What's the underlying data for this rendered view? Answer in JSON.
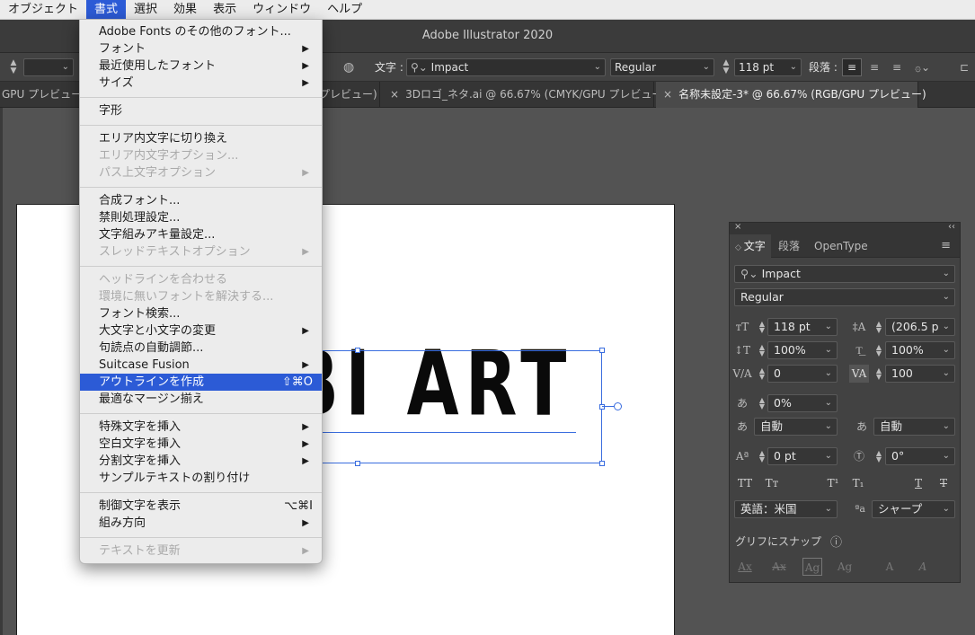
{
  "menubar": {
    "items": [
      "オブジェクト",
      "書式",
      "選択",
      "効果",
      "表示",
      "ウィンドウ",
      "ヘルプ"
    ]
  },
  "app_title": "Adobe Illustrator 2020",
  "control_bar": {
    "type_label": "文字 :",
    "font": "Impact",
    "style": "Regular",
    "size": "118 pt",
    "paragraph_label": "段落 :"
  },
  "doc_tabs": [
    {
      "label": "GPU プレビュー)"
    },
    {
      "label": "プレビュー)"
    },
    {
      "label": "3Dロゴ_ネタ.ai @ 66.67% (CMYK/GPU プレビュー)"
    },
    {
      "label": "名称未設定-3* @ 66.67% (RGB/GPU プレビュー)"
    }
  ],
  "canvas": {
    "art_text": "BI ART"
  },
  "type_menu": {
    "items": [
      {
        "label": "Adobe Fonts のその他のフォント...",
        "sub": false,
        "disabled": false
      },
      {
        "label": "フォント",
        "sub": true,
        "disabled": false
      },
      {
        "label": "最近使用したフォント",
        "sub": true,
        "disabled": false
      },
      {
        "label": "サイズ",
        "sub": true,
        "disabled": false
      },
      {
        "label": "字形",
        "sub": false,
        "disabled": false
      },
      {
        "label": "エリア内文字に切り換え",
        "sub": false,
        "disabled": false
      },
      {
        "label": "エリア内文字オプション...",
        "sub": false,
        "disabled": true
      },
      {
        "label": "パス上文字オプション",
        "sub": true,
        "disabled": true
      },
      {
        "label": "合成フォント...",
        "sub": false,
        "disabled": false
      },
      {
        "label": "禁則処理設定...",
        "sub": false,
        "disabled": false
      },
      {
        "label": "文字組みアキ量設定...",
        "sub": false,
        "disabled": false
      },
      {
        "label": "スレッドテキストオプション",
        "sub": true,
        "disabled": true
      },
      {
        "label": "ヘッドラインを合わせる",
        "sub": false,
        "disabled": true
      },
      {
        "label": "環境に無いフォントを解決する...",
        "sub": false,
        "disabled": true
      },
      {
        "label": "フォント検索...",
        "sub": false,
        "disabled": false
      },
      {
        "label": "大文字と小文字の変更",
        "sub": true,
        "disabled": false
      },
      {
        "label": "句読点の自動調節...",
        "sub": false,
        "disabled": false
      },
      {
        "label": "Suitcase Fusion",
        "sub": true,
        "disabled": false
      },
      {
        "label": "アウトラインを作成",
        "sub": false,
        "disabled": false,
        "shortcut": "⇧⌘O",
        "selected": true
      },
      {
        "label": "最適なマージン揃え",
        "sub": false,
        "disabled": false
      },
      {
        "label": "特殊文字を挿入",
        "sub": true,
        "disabled": false
      },
      {
        "label": "空白文字を挿入",
        "sub": true,
        "disabled": false
      },
      {
        "label": "分割文字を挿入",
        "sub": true,
        "disabled": false
      },
      {
        "label": "サンプルテキストの割り付け",
        "sub": false,
        "disabled": false
      },
      {
        "label": "制御文字を表示",
        "sub": false,
        "disabled": false,
        "shortcut": "⌥⌘I"
      },
      {
        "label": "組み方向",
        "sub": true,
        "disabled": false
      },
      {
        "label": "テキストを更新",
        "sub": true,
        "disabled": true
      }
    ]
  },
  "char_panel": {
    "tabs": [
      "文字",
      "段落",
      "OpenType"
    ],
    "font": "Impact",
    "style": "Regular",
    "size": "118 pt",
    "leading": "(206.5 p",
    "vscale": "100%",
    "hscale": "100%",
    "kerning": "0",
    "tracking": "100",
    "tsume": "0%",
    "aki_left": "自動",
    "aki_right": "自動",
    "baseline_shift": "0 pt",
    "rotation": "0°",
    "language": "英語：米国",
    "antialias": "シャープ",
    "snap_label": "グリフにスナップ",
    "type_buttons": [
      "TT",
      "Tт",
      "T¹",
      "T₁",
      "T",
      "T"
    ],
    "snap_buttons": [
      "Ax",
      "Ax",
      "Ag",
      "Ag",
      "A",
      "A"
    ]
  },
  "icons": {
    "submenu": "chevron-right-icon",
    "dropdown": "chevron-down-icon",
    "spinner": "up-down-spinner-icon",
    "info": "info-icon",
    "panel_menu": "hamburger-icon",
    "close": "close-icon"
  },
  "colors": {
    "menu_highlight": "#2c5bd6",
    "selection": "#3a6ddf"
  }
}
